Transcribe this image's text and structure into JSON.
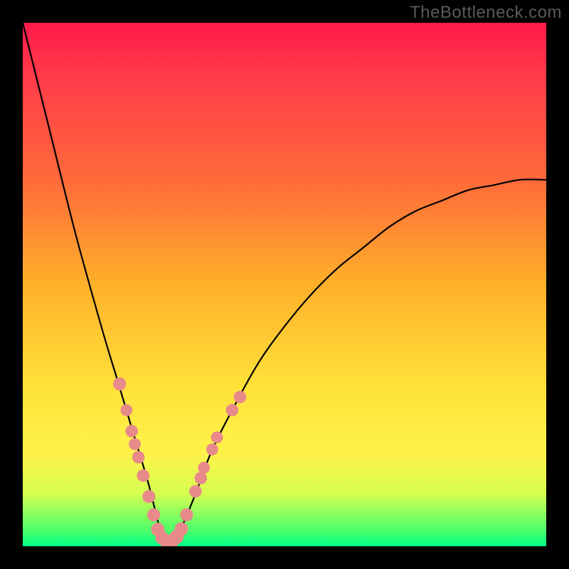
{
  "watermark": "TheBottleneck.com",
  "colors": {
    "frame": "#000000",
    "curve": "#000000",
    "dots": "#e88a8a",
    "gradient_top": "#ff1a4a",
    "gradient_mid": "#ffe23a",
    "gradient_bottom": "#00ff88"
  },
  "chart_data": {
    "type": "line",
    "title": "",
    "xlabel": "",
    "ylabel": "",
    "xlim": [
      0,
      100
    ],
    "ylim": [
      0,
      100
    ],
    "grid": false,
    "legend": false,
    "note": "Axes unlabeled; x and y are normalized 0–100. Curve shows V-shaped bottleneck profile with minimum near x≈27. Color gradient encodes bottleneck percentage (red=high, green=low).",
    "series": [
      {
        "name": "bottleneck-curve",
        "x": [
          0,
          5,
          10,
          15,
          18,
          21,
          24,
          26,
          27,
          28,
          30,
          33,
          36,
          40,
          45,
          50,
          55,
          60,
          65,
          70,
          75,
          80,
          85,
          90,
          95,
          100
        ],
        "values": [
          100,
          80,
          60,
          42,
          32,
          22,
          12,
          4,
          1,
          1,
          3,
          10,
          18,
          26,
          35,
          42,
          48,
          53,
          57,
          61,
          64,
          66,
          68,
          69,
          70,
          70
        ]
      }
    ],
    "annotations": {
      "name": "highlight-dots",
      "note": "Salmon-colored marker dots clustered along both arms of the V near the trough. Coordinates in same 0–100 normalized space.",
      "points": [
        {
          "x": 18.5,
          "y": 31,
          "r": 1.4
        },
        {
          "x": 19.8,
          "y": 26,
          "r": 1.2
        },
        {
          "x": 20.8,
          "y": 22,
          "r": 1.3
        },
        {
          "x": 21.4,
          "y": 19.5,
          "r": 1.2
        },
        {
          "x": 22.1,
          "y": 17,
          "r": 1.3
        },
        {
          "x": 23.0,
          "y": 13.5,
          "r": 1.3
        },
        {
          "x": 24.1,
          "y": 9.5,
          "r": 1.4
        },
        {
          "x": 25.0,
          "y": 6,
          "r": 1.4
        },
        {
          "x": 25.8,
          "y": 3.2,
          "r": 1.5
        },
        {
          "x": 26.6,
          "y": 1.6,
          "r": 1.5
        },
        {
          "x": 27.5,
          "y": 0.9,
          "r": 1.6
        },
        {
          "x": 28.5,
          "y": 1.0,
          "r": 1.6
        },
        {
          "x": 29.4,
          "y": 1.8,
          "r": 1.6
        },
        {
          "x": 30.3,
          "y": 3.3,
          "r": 1.5
        },
        {
          "x": 31.3,
          "y": 6,
          "r": 1.4
        },
        {
          "x": 33.0,
          "y": 10.5,
          "r": 1.3
        },
        {
          "x": 34.0,
          "y": 13,
          "r": 1.3
        },
        {
          "x": 34.6,
          "y": 15,
          "r": 1.2
        },
        {
          "x": 36.2,
          "y": 18.5,
          "r": 1.2
        },
        {
          "x": 37.1,
          "y": 20.8,
          "r": 1.2
        },
        {
          "x": 40.0,
          "y": 26,
          "r": 1.3
        },
        {
          "x": 41.5,
          "y": 28.5,
          "r": 1.3
        }
      ]
    }
  }
}
